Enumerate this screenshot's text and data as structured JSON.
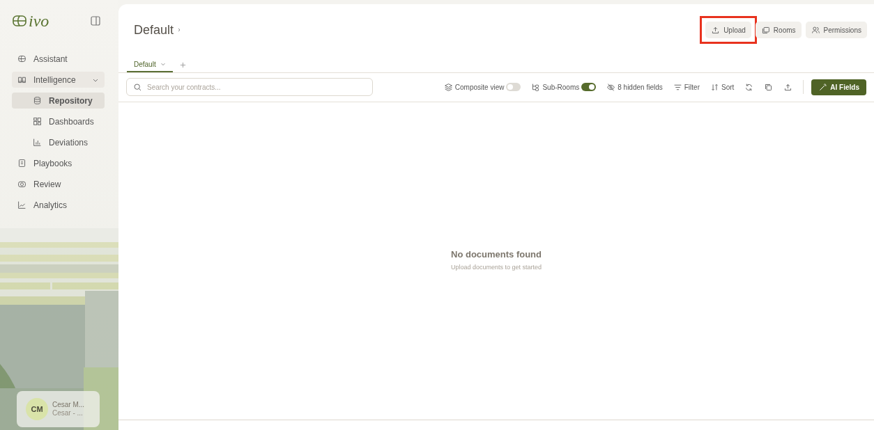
{
  "sidebar": {
    "logo": "ivo",
    "nav": [
      {
        "label": "Assistant",
        "kind": "assistant",
        "selected": false
      },
      {
        "label": "Intelligence",
        "kind": "book",
        "selected": false,
        "expanded": true,
        "children": [
          {
            "label": "Repository",
            "kind": "database",
            "selected": true
          },
          {
            "label": "Dashboards",
            "kind": "grid",
            "selected": false
          },
          {
            "label": "Deviations",
            "kind": "bars",
            "selected": false
          }
        ]
      },
      {
        "label": "Playbooks",
        "kind": "doc",
        "selected": false
      },
      {
        "label": "Review",
        "kind": "review",
        "selected": false
      },
      {
        "label": "Analytics",
        "kind": "chart",
        "selected": false
      }
    ],
    "user": {
      "initials": "CM",
      "name": "Cesar M...",
      "subtitle": "Cesar - ..."
    }
  },
  "header": {
    "title": "Default",
    "buttons": [
      {
        "label": "Upload",
        "kind": "upload",
        "highlighted": true
      },
      {
        "label": "Rooms",
        "kind": "rooms",
        "highlighted": false
      },
      {
        "label": "Permissions",
        "kind": "users",
        "highlighted": false
      }
    ]
  },
  "tabs": [
    {
      "label": "Default",
      "selected": true
    }
  ],
  "search": {
    "placeholder": "Search your contracts..."
  },
  "toolbar": [
    {
      "kind": "toggle",
      "label": "Composite view",
      "on": false
    },
    {
      "kind": "toggle",
      "label": "Sub-Rooms",
      "on": true
    },
    {
      "kind": "action",
      "label": "8 hidden fields"
    },
    {
      "kind": "action",
      "label": "Filter"
    },
    {
      "kind": "action",
      "label": "Sort"
    },
    {
      "kind": "icon"
    },
    {
      "kind": "icon"
    },
    {
      "kind": "icon"
    },
    {
      "kind": "primary",
      "label": "AI Fields"
    }
  ],
  "empty_state": {
    "title": "No documents found",
    "subtitle": "Upload documents to get started"
  }
}
